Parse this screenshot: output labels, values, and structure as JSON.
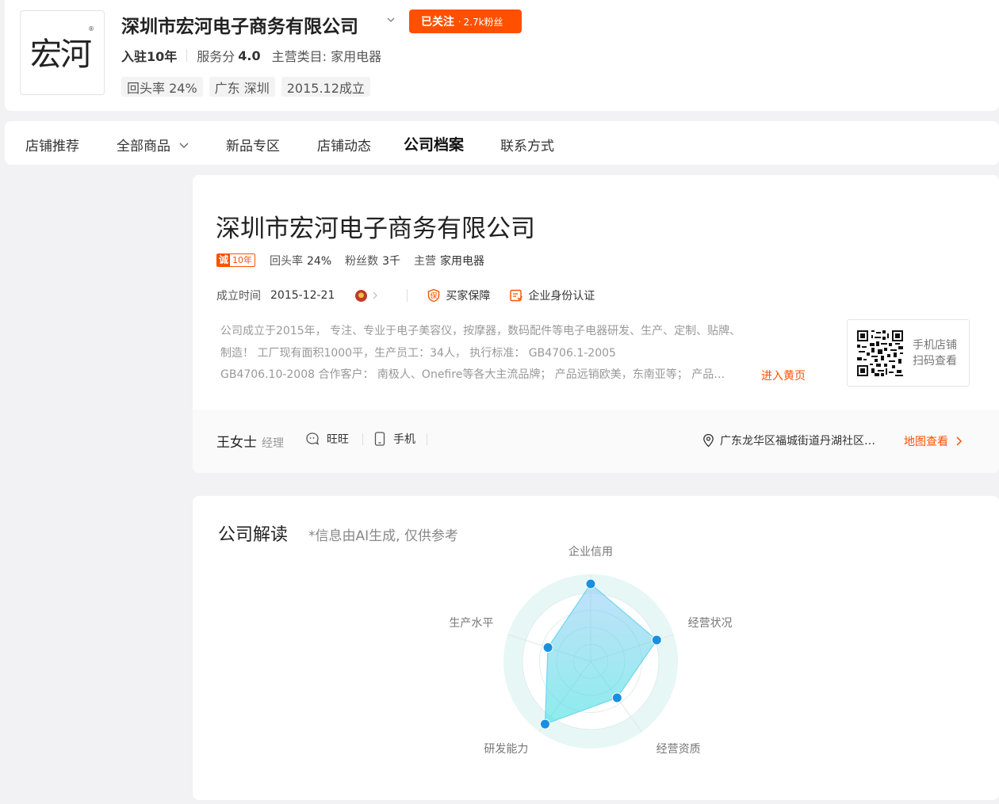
{
  "header": {
    "logo_text": "宏河",
    "logo_reg": "®",
    "shop_name": "深圳市宏河电子商务有限公司",
    "follow_label": "已关注",
    "follow_sep": "·",
    "fans_count": "2.7k粉丝",
    "years": "入驻10年",
    "service_label": "服务分",
    "service_score": "4.0",
    "category": "主营类目: 家用电器",
    "tags": [
      "回头率 24%",
      "广东 深圳",
      "2015.12成立"
    ]
  },
  "nav": {
    "items": [
      "店铺推荐",
      "全部商品",
      "新品专区",
      "店铺动态",
      "公司档案",
      "联系方式"
    ],
    "active": "公司档案"
  },
  "profile": {
    "title": "深圳市宏河电子商务有限公司",
    "badge_icon": "诚",
    "badge_years": "10年",
    "repeat_label": "回头率",
    "repeat_value": "24%",
    "fans_label": "粉丝数",
    "fans_value": "3千",
    "main_label": "主营",
    "main_value": "家用电器",
    "est_label": "成立时间",
    "est_value": "2015-12-21",
    "guarantee": "买家保障",
    "verify": "企业身份认证",
    "desc_lines": [
      "公司成立于2015年， 专注、专业于电子美容仪，按摩器，数码配件等电子电器研发、生产、定制、贴牌、",
      "制造！ 工厂现有面积1000平，生产员工：34人， 执行标准： GB4706.1-2005",
      "GB4706.10-2008 合作客户： 南极人、Onefire等各大主流品牌； 产品远销欧美，东南亚等； 产品…"
    ],
    "yellow_link": "进入黄页",
    "qr_line1": "手机店铺",
    "qr_line2": "扫码查看",
    "contact_name": "王女士",
    "contact_role": "经理",
    "wangwang": "旺旺",
    "phone": "手机",
    "address": "广东龙华区福城街道丹湖社区…",
    "map_link": "地图查看"
  },
  "ai": {
    "title": "公司解读",
    "note": "*信息由AI生成, 仅供参考"
  },
  "chart_data": {
    "type": "radar",
    "axes": [
      "企业信用",
      "经营状况",
      "经营资质",
      "研发能力",
      "生产水平"
    ],
    "values": [
      0.95,
      0.85,
      0.55,
      0.95,
      0.55
    ],
    "range": [
      0,
      1
    ],
    "fill_color": "#7ec8f4",
    "point_color": "#1a8fe0",
    "ring_color": "#e6f7f6"
  }
}
